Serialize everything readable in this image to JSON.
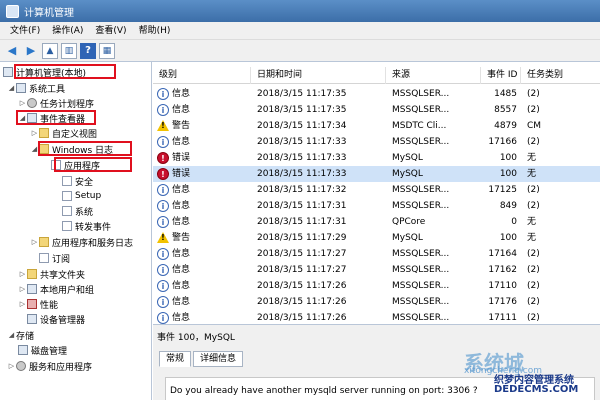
{
  "window": {
    "title": "计算机管理"
  },
  "menu": [
    "文件(F)",
    "操作(A)",
    "查看(V)",
    "帮助(H)"
  ],
  "tree": {
    "root": "计算机管理(本地)",
    "system_tools": "系统工具",
    "task_scheduler": "任务计划程序",
    "event_viewer": "事件查看器",
    "custom_views": "自定义视图",
    "windows_logs": "Windows 日志",
    "application": "应用程序",
    "security": "安全",
    "setup": "Setup",
    "system": "系统",
    "forwarded_events": "转发事件",
    "app_service_logs": "应用程序和服务日志",
    "subscriptions": "订阅",
    "shared_folders": "共享文件夹",
    "local_users_groups": "本地用户和组",
    "performance": "性能",
    "device_manager": "设备管理器",
    "storage": "存储",
    "disk_management": "磁盘管理",
    "services_apps": "服务和应用程序"
  },
  "columns": [
    "级别",
    "日期和时间",
    "来源",
    "事件 ID",
    "任务类别"
  ],
  "events": [
    {
      "level": "信息",
      "type": "info",
      "datetime": "2018/3/15 11:17:35",
      "source": "MSSQLSER...",
      "id": "1485",
      "category": "(2)"
    },
    {
      "level": "信息",
      "type": "info",
      "datetime": "2018/3/15 11:17:35",
      "source": "MSSQLSER...",
      "id": "8557",
      "category": "(2)"
    },
    {
      "level": "警告",
      "type": "warn",
      "datetime": "2018/3/15 11:17:34",
      "source": "MSDTC Cli...",
      "id": "4879",
      "category": "CM"
    },
    {
      "level": "信息",
      "type": "info",
      "datetime": "2018/3/15 11:17:33",
      "source": "MSSQLSER...",
      "id": "17166",
      "category": "(2)"
    },
    {
      "level": "错误",
      "type": "err",
      "datetime": "2018/3/15 11:17:33",
      "source": "MySQL",
      "id": "100",
      "category": "无"
    },
    {
      "level": "错误",
      "type": "err",
      "datetime": "2018/3/15 11:17:33",
      "source": "MySQL",
      "id": "100",
      "category": "无"
    },
    {
      "level": "信息",
      "type": "info",
      "datetime": "2018/3/15 11:17:32",
      "source": "MSSQLSER...",
      "id": "17125",
      "category": "(2)"
    },
    {
      "level": "信息",
      "type": "info",
      "datetime": "2018/3/15 11:17:31",
      "source": "MSSQLSER...",
      "id": "849",
      "category": "(2)"
    },
    {
      "level": "信息",
      "type": "info",
      "datetime": "2018/3/15 11:17:31",
      "source": "QPCore",
      "id": "0",
      "category": "无"
    },
    {
      "level": "警告",
      "type": "warn",
      "datetime": "2018/3/15 11:17:29",
      "source": "MySQL",
      "id": "100",
      "category": "无"
    },
    {
      "level": "信息",
      "type": "info",
      "datetime": "2018/3/15 11:17:27",
      "source": "MSSQLSER...",
      "id": "17164",
      "category": "(2)"
    },
    {
      "level": "信息",
      "type": "info",
      "datetime": "2018/3/15 11:17:27",
      "source": "MSSQLSER...",
      "id": "17162",
      "category": "(2)"
    },
    {
      "level": "信息",
      "type": "info",
      "datetime": "2018/3/15 11:17:26",
      "source": "MSSQLSER...",
      "id": "17110",
      "category": "(2)"
    },
    {
      "level": "信息",
      "type": "info",
      "datetime": "2018/3/15 11:17:26",
      "source": "MSSQLSER...",
      "id": "17176",
      "category": "(2)"
    },
    {
      "level": "信息",
      "type": "info",
      "datetime": "2018/3/15 11:17:26",
      "source": "MSSQLSER...",
      "id": "17111",
      "category": "(2)"
    }
  ],
  "detail": {
    "title": "事件 100，MySQL",
    "tab_general": "常规",
    "tab_details": "详细信息",
    "description": "Do you already have another mysqld server running on port: 3306 ?"
  },
  "watermark": {
    "logo": "系统城",
    "domain": "xitongcheng.com",
    "site_name": "织梦内容管理系统",
    "site_url": "DEDECMS.COM"
  }
}
